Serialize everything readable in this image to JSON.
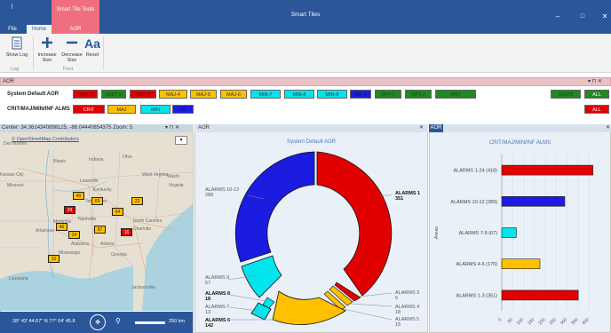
{
  "window": {
    "title": "Smart Tiles",
    "context_tab_group": "Smart Tile Tools",
    "minimize": "–",
    "maximize": "□",
    "close": "✕"
  },
  "ribbon": {
    "tabs": [
      "File",
      "Home",
      "AOR"
    ],
    "buttons": {
      "show_log": "Show Log",
      "increase_size_1": "Increase",
      "increase_size_2": "Size",
      "decrease_size_1": "Decrease",
      "decrease_size_2": "Size",
      "reset": "Reset"
    },
    "groups": {
      "log": "Log",
      "font": "Font"
    }
  },
  "aor_bar": {
    "label": "AOR",
    "controls": "▾ ⊓ ✕"
  },
  "tile_rows": [
    {
      "label": "System Default AOR",
      "tiles": [
        {
          "text": "UNIT-1",
          "bg": "#e00000",
          "fg": "#7a0000"
        },
        {
          "text": "UNIT-2",
          "bg": "#1f8a1f",
          "fg": "#0b4b0b"
        },
        {
          "text": "CRIT-3",
          "bg": "#e00000",
          "fg": "#7a0000"
        },
        {
          "text": "MAJ-4",
          "bg": "#ffc000",
          "fg": "#333333"
        },
        {
          "text": "MAJ-5",
          "bg": "#ffc000",
          "fg": "#333333"
        },
        {
          "text": "MAJ-6",
          "bg": "#ffc000",
          "fg": "#333333"
        },
        {
          "text": "MIN-7",
          "bg": "#00e5ee",
          "fg": "#333333"
        },
        {
          "text": "MIN-8",
          "bg": "#00e5ee",
          "fg": "#333333"
        },
        {
          "text": "MIN-9",
          "bg": "#00e5ee",
          "fg": "#333333"
        },
        {
          "text": "INF-1",
          "bg": "#1c1ce0",
          "fg": "#101080"
        },
        {
          "text": "OPT-1",
          "bg": "#1f8a1f",
          "fg": "#0b4b0b"
        },
        {
          "text": "OPT-2",
          "bg": "#1f8a1f",
          "fg": "#0b4b0b"
        },
        {
          "text": "MNT",
          "bg": "#1f8a1f",
          "fg": "#0b4b0b"
        },
        {
          "text": "STATS",
          "bg": "#1f8a1f",
          "fg": "#0b4b0b"
        },
        {
          "text": "ALL",
          "bg": "#1f8a1f",
          "fg": "#ffffff"
        }
      ]
    },
    {
      "label": "CRIT/MAJ/MIN/INF ALMS",
      "tiles": [
        {
          "text": "CRIT",
          "bg": "#e00000",
          "fg": "#ffffff"
        },
        {
          "text": "MAJ",
          "bg": "#ffc000",
          "fg": "#333333"
        },
        {
          "text": "MIN",
          "bg": "#00e5ee",
          "fg": "#333333"
        },
        {
          "text": "INF",
          "bg": "#1c1ce0",
          "fg": "#101080"
        },
        {
          "text": "ALL",
          "bg": "#e00000",
          "fg": "#ffffff"
        }
      ]
    }
  ],
  "map_panel": {
    "header": "Center: 34.3614340898125, -86.0444085437​5 Zoom: 5",
    "controls": "▾ ⊓ ✕",
    "attribution": "© OpenStreetMap Contributors",
    "place_labels": [
      "Des Moines",
      "Illinois",
      "Indiana",
      "Ohio",
      "Kansas City",
      "Missouri",
      "Louisville",
      "Kentucky",
      "West Virginia",
      "Washi",
      "Virginia",
      "Tennessee",
      "Memphis",
      "Arkansas",
      "Nashville",
      "North Carolina",
      "Charlotte",
      "Atlanta",
      "Mississippi",
      "Alabama",
      "Georgia",
      "Louisiana",
      "Jacksonville"
    ],
    "markers": [
      {
        "text": "40",
        "bg": "#ffc000"
      },
      {
        "text": "69",
        "bg": "#ffc000"
      },
      {
        "text": "22",
        "bg": "#ffc000"
      },
      {
        "text": "29",
        "bg": "#e00000"
      },
      {
        "text": "64",
        "bg": "#ffc000"
      },
      {
        "text": "46",
        "bg": "#ffc000"
      },
      {
        "text": "24",
        "bg": "#ffc000"
      },
      {
        "text": "87",
        "bg": "#ffc000"
      },
      {
        "text": "16",
        "bg": "#e00000"
      },
      {
        "text": "10",
        "bg": "#ffc000"
      }
    ],
    "coords": "28° 43' 44.67\" N 77° 04' 45.8",
    "scale": "250 km"
  },
  "donut_panel": {
    "tab": "AOR",
    "close": "✕",
    "title": "System Default AOR",
    "labels": [
      {
        "line1": "ALARMS 10-12",
        "line2": "289",
        "bold": false
      },
      {
        "line1": "ALARMS 1",
        "line2": "351",
        "bold": true
      },
      {
        "line1": "ALARMS 9",
        "line2": "67",
        "bold": false
      },
      {
        "line1": "ALARMS 8",
        "line2": "18",
        "bold": true
      },
      {
        "line1": "ALARMS 7",
        "line2": "13",
        "bold": false
      },
      {
        "line1": "ALARMS 6",
        "line2": "142",
        "bold": true
      },
      {
        "line1": "ALARMS 3",
        "line2": "5",
        "bold": false
      },
      {
        "line1": "ALARMS 4",
        "line2": "18",
        "bold": false
      },
      {
        "line1": "ALARMS 5",
        "line2": "15",
        "bold": false
      }
    ]
  },
  "bar_panel": {
    "tab": "AOR",
    "close": "✕"
  },
  "chart_data": {
    "type": "bar",
    "orientation": "horizontal",
    "title": "CRIT/MAJ/MIN/INF ALMS",
    "ylabel": "Areas",
    "categories": [
      "ALARMS 1-24 (418)",
      "ALARMS 10-12 (289)",
      "ALARMS 7-9 (67)",
      "ALARMS 4-6 (175)",
      "ALARMS 1-3 (351)"
    ],
    "values": [
      418,
      289,
      67,
      175,
      351
    ],
    "colors": [
      "#e00000",
      "#1c1ce0",
      "#00e5ee",
      "#ffc000",
      "#e00000"
    ],
    "xticks": [
      0,
      50,
      100,
      150,
      200,
      250,
      300,
      350,
      400
    ],
    "xlim": [
      0,
      440
    ],
    "grid": true
  }
}
